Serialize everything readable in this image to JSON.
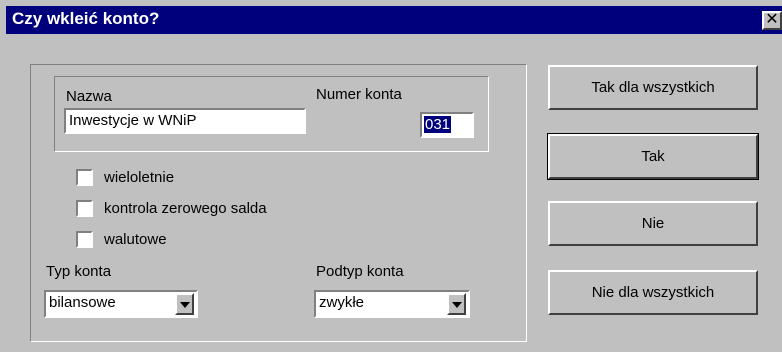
{
  "window": {
    "title": "Czy wkleić konto?",
    "close_glyph": "✕"
  },
  "account": {
    "name_label": "Nazwa",
    "name_value": "Inwestycje w WNiP",
    "number_label": "Numer konta",
    "number_value": "031"
  },
  "options": {
    "multiyear_label": "wieloletnie",
    "multiyear_checked": false,
    "zero_balance_label": "kontrola zerowego salda",
    "zero_balance_checked": false,
    "currency_label": "walutowe",
    "currency_checked": false
  },
  "type": {
    "type_label": "Typ konta",
    "type_value": "bilansowe",
    "subtype_label": "Podtyp konta",
    "subtype_value": "zwykłe"
  },
  "buttons": {
    "yes_all": "Tak dla wszystkich",
    "yes": "Tak",
    "no": "Nie",
    "no_all": "Nie dla wszystkich"
  }
}
